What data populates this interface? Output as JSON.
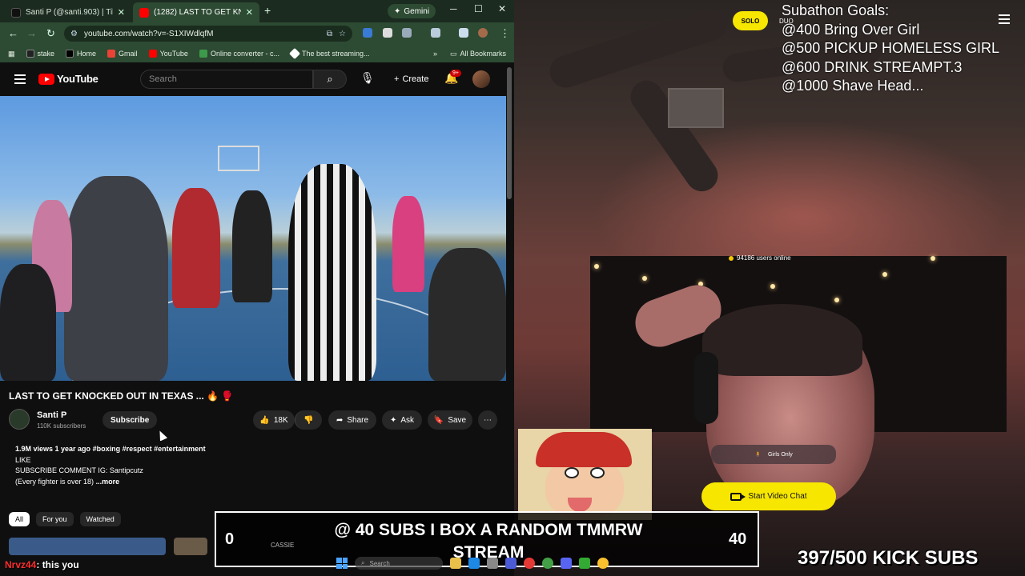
{
  "browser": {
    "tabs": [
      {
        "title": "Santi P (@santi.903) | TikTok",
        "active": false
      },
      {
        "title": "(1282) LAST TO GET KNOCK",
        "active": true
      }
    ],
    "gemini_label": "Gemini",
    "url": "youtube.com/watch?v=-S1XIWdlqfM",
    "bookmarks": [
      "stake",
      "Home",
      "Gmail",
      "YouTube",
      "Online converter - c...",
      "The best streaming..."
    ],
    "all_bookmarks": "All Bookmarks"
  },
  "youtube": {
    "logo_text": "YouTube",
    "search_placeholder": "Search",
    "create_label": "Create",
    "notif_count": "9+",
    "video_title": "LAST TO GET KNOCKED OUT IN TEXAS ... 🔥 🥊",
    "channel_name": "Santi P",
    "channel_subs": "110K subscribers",
    "subscribe_label": "Subscribe",
    "likes": "18K",
    "share_label": "Share",
    "ask_label": "Ask",
    "save_label": "Save",
    "desc_meta": "1.9M views  1 year ago",
    "desc_tags": "#boxing #respect #entertainment",
    "desc_line2": "LIKE",
    "desc_line3": "SUBSCRIBE COMMENT IG: Santipcutz",
    "desc_line4": "(Every fighter is over 18)",
    "desc_more": "...more",
    "chips": [
      "All",
      "For you",
      "Watched"
    ]
  },
  "stream": {
    "goals_title": "Subathon Goals:",
    "goals": [
      "@400 Bring Over Girl",
      "@500 PICKUP HOMELESS GIRL",
      "@600 DRINK STREAMPT.3",
      "@1000 Shave Head..."
    ],
    "mode_solo": "SOLO",
    "mode_duo": "DUO",
    "users_online": "94186 users online",
    "girls_only": "Girls Only",
    "start_video_chat": "Start Video Chat"
  },
  "overlay": {
    "sub_goal_text": "@ 40 SUBS I BOX A RANDOM TMMRW STREAM",
    "sub_goal_start": "0",
    "sub_goal_end": "40",
    "cassie_label": "CASSIE",
    "kick_subs": "397/500 KICK SUBS",
    "chat_user": "Nrvz44",
    "chat_message": ": this you",
    "taskbar_search": "Search"
  },
  "colors": {
    "browser_frame": "#2d4a33",
    "yt_red": "#ff0000",
    "stream_yellow": "#f7e600",
    "chat_user": "#ff2d2d"
  }
}
